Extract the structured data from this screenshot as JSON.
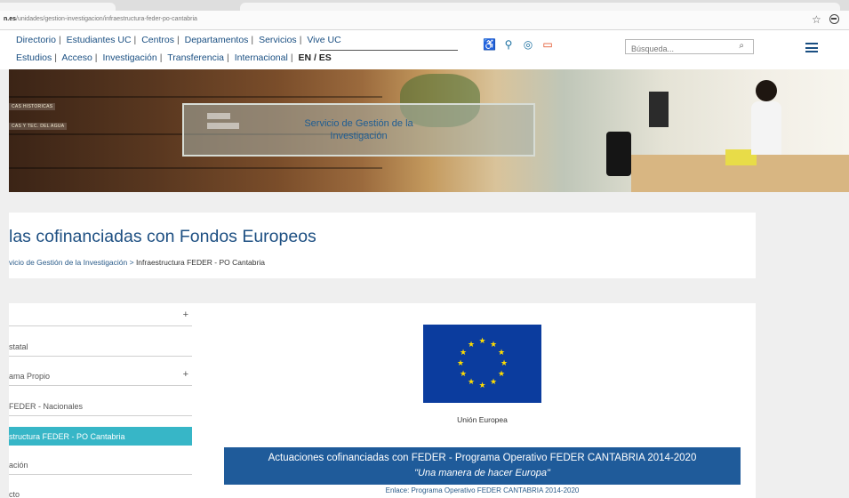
{
  "browser": {
    "url_host": "n.es",
    "url_path": "/unidades/gestion-investigacion/infraestructura-feder-po-cantabria"
  },
  "nav": {
    "row1": [
      "Directorio",
      "Estudiantes UC",
      "Centros",
      "Departamentos",
      "Servicios",
      "Vive UC"
    ],
    "row2": [
      "Estudios",
      "Acceso",
      "Investigación",
      "Transferencia",
      "Internacional"
    ],
    "lang": "EN / ES"
  },
  "header_icons": [
    "accessibility-icon",
    "location-icon",
    "instagram-icon",
    "screen-icon"
  ],
  "search": {
    "placeholder": "Búsqueda..."
  },
  "banner": {
    "title": "Servicio de Gestión de la Investigación",
    "label1": "CAS HISTORICAS",
    "label2": "CAS Y TEC. DEL AGUA"
  },
  "page": {
    "title": "las cofinanciadas con Fondos Europeos",
    "breadcrumb_link": "vicio de Gestión de la Investigación",
    "breadcrumb_sep": " > ",
    "breadcrumb_current": "Infraestructura FEDER - PO Cantabria"
  },
  "sidebar": {
    "items": [
      {
        "label": "",
        "plus": "+"
      },
      {
        "label": "statal",
        "plus": ""
      },
      {
        "label": "ama Propio",
        "plus": "+"
      },
      {
        "label": "FEDER - Nacionales",
        "plus": ""
      },
      {
        "label": "structura FEDER - PO Cantabria",
        "plus": ""
      },
      {
        "label": "ación",
        "plus": ""
      },
      {
        "label": "cto",
        "plus": ""
      }
    ]
  },
  "eu": {
    "caption": "Unión Europea"
  },
  "feder": {
    "line1": "Actuaciones cofinanciadas con FEDER - Programa Operativo FEDER CANTABRIA 2014-2020",
    "line2": "\"Una manera de hacer Europa\"",
    "enlace_label": "Enlace:",
    "enlace_text": "Programa Operativo FEDER CANTABRIA 2014-2020"
  },
  "colors": {
    "accent": "#1f5b9a",
    "active_item": "#37b6c7",
    "nav_link": "#1a4f82",
    "eu_blue": "#0b3c9e",
    "eu_star": "#ffdd00"
  }
}
